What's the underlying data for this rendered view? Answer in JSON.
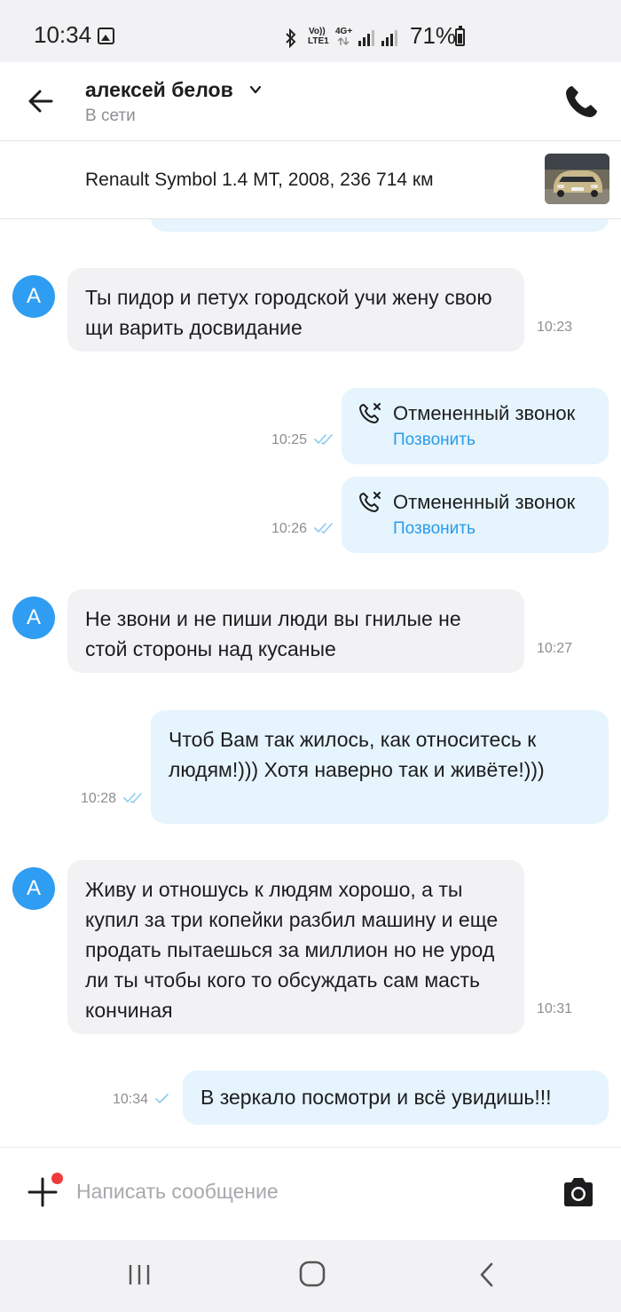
{
  "status_bar": {
    "time": "10:34",
    "volte": "Vo))",
    "lte": "LTE1",
    "network": "4G+",
    "battery": "71%",
    "icons": [
      "gallery-icon",
      "bluetooth-icon",
      "signal-icon",
      "battery-icon"
    ]
  },
  "header": {
    "contact_name": "алексей белов",
    "contact_status": "В сети",
    "icons": [
      "back-arrow-icon",
      "chevron-down-icon",
      "phone-icon"
    ]
  },
  "listing": {
    "title": "Renault Symbol 1.4 MT, 2008, 236 714 км"
  },
  "messages": [
    {
      "direction": "in",
      "avatar": "А",
      "text": "Ты пидор и петух городской учи жену свою щи варить досвидание",
      "time": "10:23"
    },
    {
      "direction": "out",
      "type": "call",
      "title": "Отмененный звонок",
      "action": "Позвонить",
      "time": "10:25",
      "status": "read"
    },
    {
      "direction": "out",
      "type": "call",
      "title": "Отмененный звонок",
      "action": "Позвонить",
      "time": "10:26",
      "status": "read"
    },
    {
      "direction": "in",
      "avatar": "А",
      "text": "Не  звони и не пиши люди вы гнилые не стой стороны над кусаные",
      "time": "10:27"
    },
    {
      "direction": "out",
      "text": "Чтоб Вам так жилось,  как относитесь к людям!))) Хотя наверно так и живёте!)))",
      "time": "10:28",
      "status": "read"
    },
    {
      "direction": "in",
      "avatar": "А",
      "text": "Живу и отношусь к людям хорошо, а ты купил  за три копейки разбил  машину и еще продать пытаешься за миллион но не урод ли ты чтобы кого то обсуждать сам масть кончиная",
      "time": "10:31"
    },
    {
      "direction": "out",
      "text": "В зеркало посмотри и всё увидишь!!!",
      "time": "10:34",
      "status": "sent"
    }
  ],
  "composer": {
    "placeholder": "Написать сообщение",
    "value": ""
  },
  "colors": {
    "accent": "#2a9bea",
    "avatar": "#2f9df1",
    "incoming_bubble": "#f2f2f4",
    "outgoing_bubble": "#e5f4fd",
    "notification_dot": "#f23a3a"
  }
}
